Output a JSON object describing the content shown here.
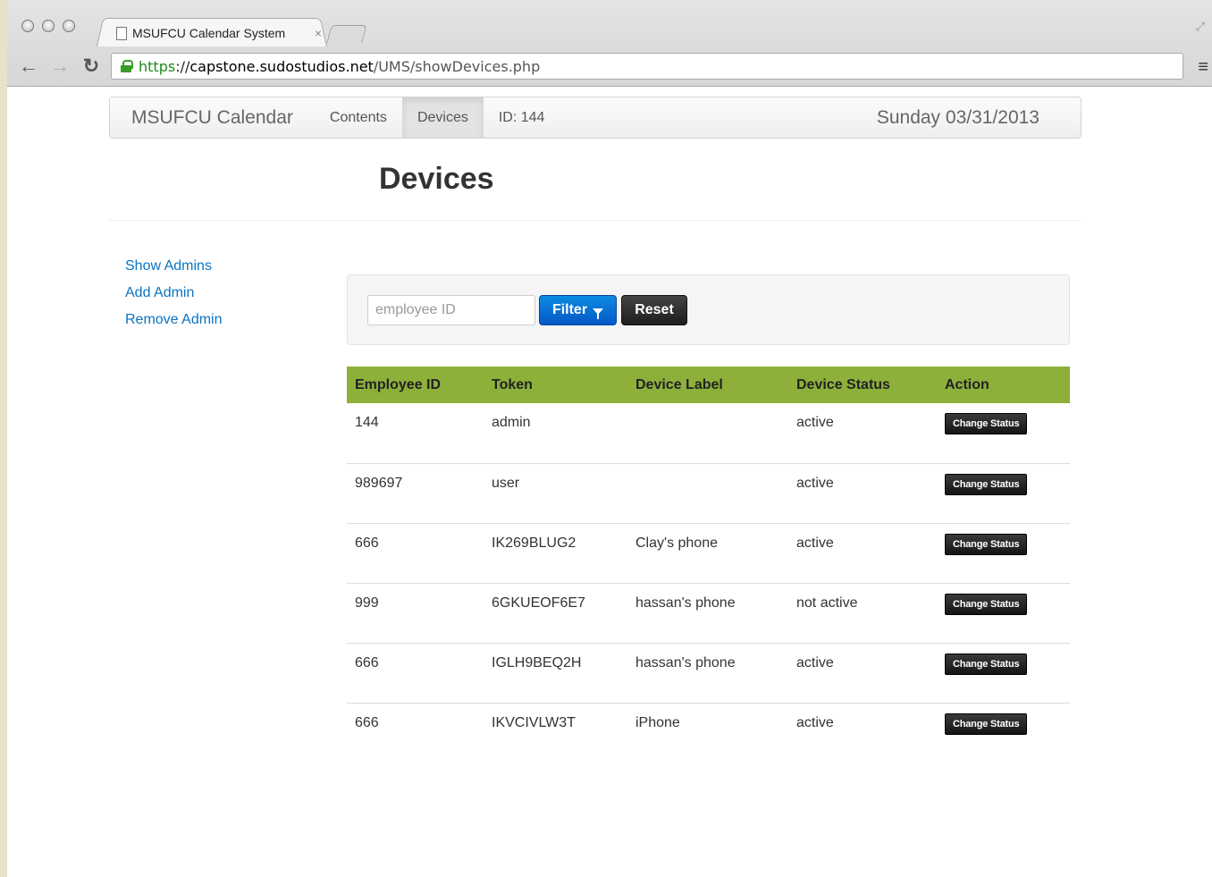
{
  "browser": {
    "tab_title": "MSUFCU Calendar System",
    "tab_close": "×",
    "url_scheme": "https",
    "url_sep": "://",
    "url_host": "capstone.sudostudios.net",
    "url_path": "/UMS/showDevices.php"
  },
  "navbar": {
    "brand": "MSUFCU Calendar",
    "items": [
      {
        "label": "Contents",
        "active": false
      },
      {
        "label": "Devices",
        "active": true
      }
    ],
    "id_label": "ID: 144",
    "date": "Sunday 03/31/2013"
  },
  "page": {
    "title": "Devices"
  },
  "sidebar": {
    "links": [
      "Show Admins",
      "Add Admin",
      "Remove Admin"
    ]
  },
  "filter": {
    "input_value": "",
    "input_placeholder": "employee ID",
    "filter_label": "Filter",
    "reset_label": "Reset"
  },
  "table": {
    "columns": [
      "Employee ID",
      "Token",
      "Device Label",
      "Device Status",
      "Action"
    ],
    "action_label": "Change Status",
    "rows": [
      {
        "employee_id": "144",
        "token": "admin",
        "label": "",
        "status": "active"
      },
      {
        "employee_id": "989697",
        "token": "user",
        "label": "",
        "status": "active"
      },
      {
        "employee_id": "666",
        "token": "IK269BLUG2",
        "label": "Clay's phone",
        "status": "active"
      },
      {
        "employee_id": "999",
        "token": "6GKUEOF6E7",
        "label": "hassan's phone",
        "status": "not active"
      },
      {
        "employee_id": "666",
        "token": "IGLH9BEQ2H",
        "label": "hassan's phone",
        "status": "active"
      },
      {
        "employee_id": "666",
        "token": "IKVCIVLW3T",
        "label": "iPhone",
        "status": "active"
      }
    ]
  },
  "colors": {
    "table_header": "#8db03b",
    "link": "#0a73c2",
    "primary_button": "#0558c8",
    "dark_button": "#1e1e1e"
  }
}
